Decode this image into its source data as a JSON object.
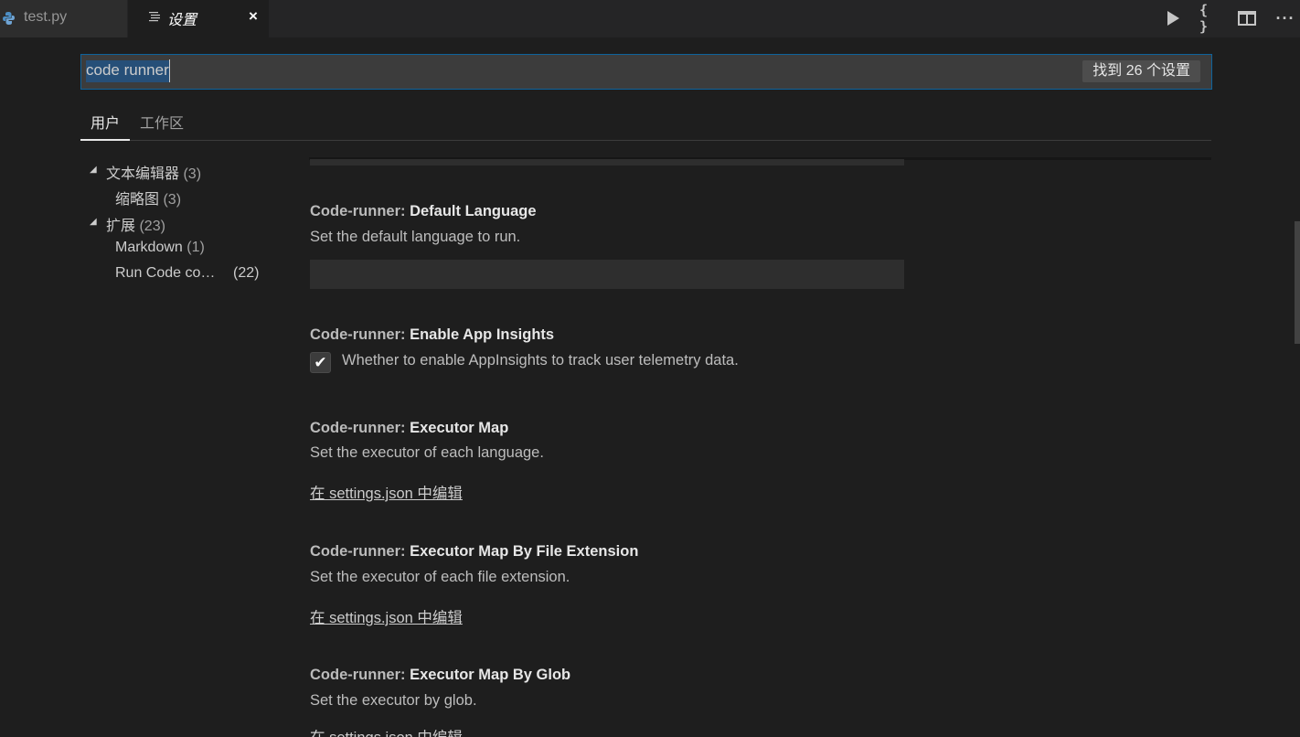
{
  "tabs": {
    "test": {
      "label": "test.py"
    },
    "settings": {
      "label": "设置",
      "close": "×"
    }
  },
  "actions": {
    "json_label": "{ }",
    "more_label": "···"
  },
  "search": {
    "value": "code runner",
    "count": "找到 26 个设置"
  },
  "scope_tabs": {
    "user": "用户",
    "workspace": "工作区"
  },
  "toc": {
    "items": [
      {
        "label": "文本编辑器",
        "count": "(3)"
      },
      {
        "label": "缩略图",
        "count": "(3)"
      },
      {
        "label": "扩展",
        "count": "(23)"
      },
      {
        "label": "Markdown",
        "count": "(1)"
      },
      {
        "label": "Run Code co…",
        "count": "(22)"
      }
    ]
  },
  "settings": [
    {
      "category": "Code-runner: ",
      "name": "Default Language",
      "description": "Set the default language to run."
    },
    {
      "category": "Code-runner: ",
      "name": "Enable App Insights",
      "description": "Whether to enable AppInsights to track user telemetry data.",
      "checked": true
    },
    {
      "category": "Code-runner: ",
      "name": "Executor Map",
      "description": "Set the executor of each language.",
      "link": "在 settings.json 中编辑"
    },
    {
      "category": "Code-runner: ",
      "name": "Executor Map By File Extension",
      "description": "Set the executor of each file extension.",
      "link": "在 settings.json 中编辑"
    },
    {
      "category": "Code-runner: ",
      "name": "Executor Map By Glob",
      "description": "Set the executor by glob.",
      "link": "在 settings.json 中编辑"
    }
  ],
  "checkbox_glyph": "✔",
  "colors": {
    "background": "#1e1e1e",
    "search_border": "#0e639c",
    "selection": "#264f78"
  }
}
